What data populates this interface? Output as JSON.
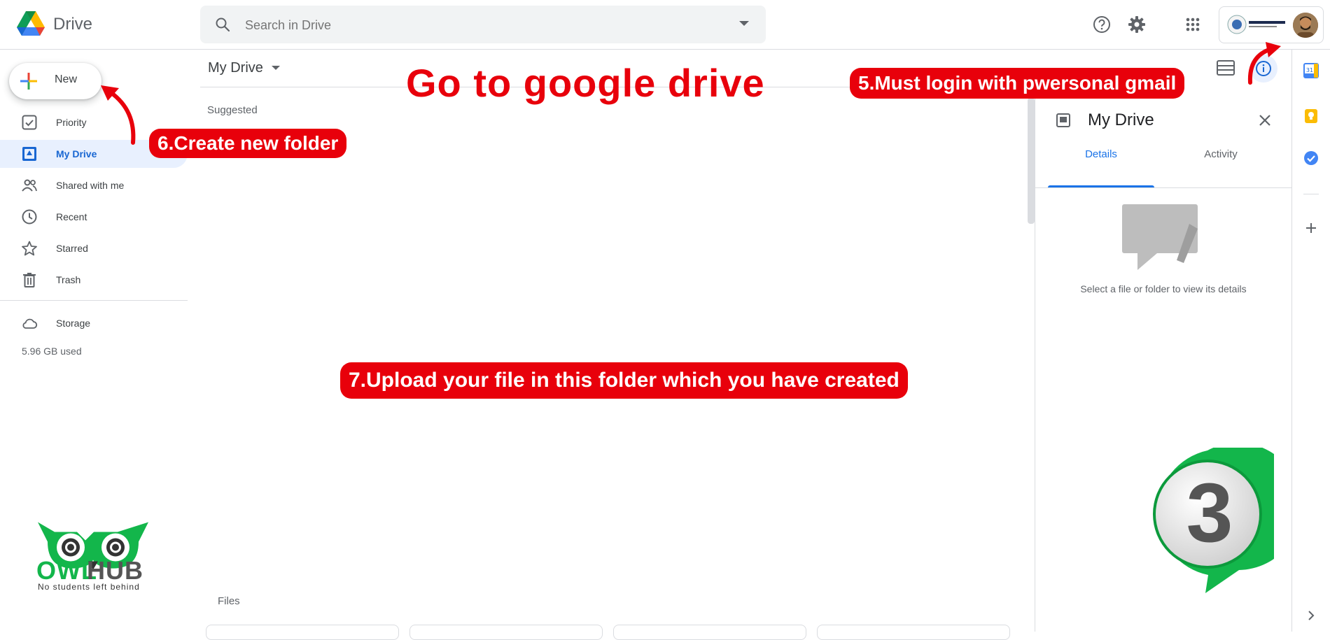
{
  "header": {
    "app_name": "Drive",
    "search_placeholder": "Search in Drive"
  },
  "sidebar": {
    "new_label": "New",
    "items": [
      {
        "label": "Priority"
      },
      {
        "label": "My Drive"
      },
      {
        "label": "Shared with me"
      },
      {
        "label": "Recent"
      },
      {
        "label": "Starred"
      },
      {
        "label": "Trash"
      }
    ],
    "storage_label": "Storage",
    "storage_used": "5.96 GB used"
  },
  "main": {
    "title": "My Drive",
    "suggested_label": "Suggested",
    "files_label": "Files"
  },
  "details": {
    "title": "My Drive",
    "tabs": [
      {
        "label": "Details",
        "active": true
      },
      {
        "label": "Activity",
        "active": false
      }
    ],
    "empty_text": "Select a file or folder to view its details"
  },
  "annotations": {
    "headline": "Go to google drive",
    "login": "5.Must login with pwersonal gmail",
    "create_folder": "6.Create new folder",
    "upload": "7.Upload your file in this folder which you have created"
  },
  "branding": {
    "owl_word_1": "OWL",
    "owl_word_2": "HUB",
    "owl_tagline": "No students left behind",
    "step_number": "3"
  },
  "colors": {
    "accent": "#1a73e8",
    "annotation_red": "#e8000b",
    "owl_green": "#13b64b"
  }
}
